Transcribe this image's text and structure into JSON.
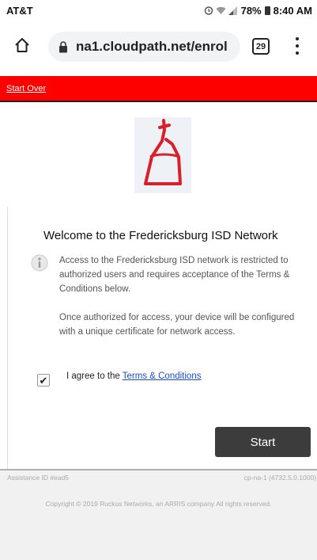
{
  "status_bar": {
    "carrier": "AT&T",
    "battery": "78%",
    "time": "8:40 AM"
  },
  "browser": {
    "url": "na1.cloudpath.net/enrol",
    "tab_count": "29"
  },
  "header": {
    "start_over": "Start Over"
  },
  "main": {
    "welcome_title": "Welcome to the Fredericksburg ISD Network",
    "paragraph_1": "Access to the Fredericksburg ISD network is restricted to authorized users and requires acceptance of the Terms & Conditions below.",
    "paragraph_2": "Once authorized for access, your device will be configured with a unique certificate for network access.",
    "agree_prefix": "I agree to the ",
    "terms_link": "Terms & Conditions",
    "checkbox_checked": true,
    "start_label": "Start"
  },
  "footer": {
    "assistance_id": "Assistance ID #ead5",
    "version": "cp-na-1 (4732.5.0.1000)",
    "copyright": "Copyright © 2019 Ruckus Networks, an ARRIS company All rights reserved."
  },
  "colors": {
    "header_red": "#ff0000",
    "button_dark": "#3c3c3c",
    "logo_red": "#d8202a",
    "link_blue": "#1a4bd8"
  }
}
